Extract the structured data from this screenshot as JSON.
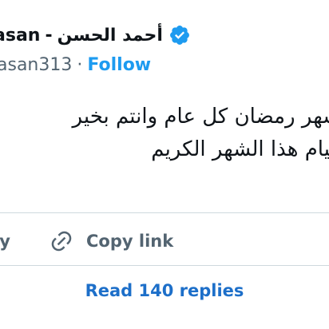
{
  "author": {
    "name_arabic": "أحمد الحسن",
    "separator": "-",
    "name_latin_fragment": "asan",
    "handle_fragment": "asan313",
    "dot": "·",
    "follow_label": "Follow",
    "verified_icon": "verified-badge-icon"
  },
  "tweet": {
    "lines": [
      "شهر رمضان كل عام وانتم بخير",
      "قيام هذا الشهر الكريم"
    ]
  },
  "actions": {
    "reply_label_fragment": "ly",
    "copy_link_label": "Copy link",
    "copy_link_icon": "link-icon"
  },
  "replies": {
    "read_label": "Read 140 replies"
  },
  "colors": {
    "accent": "#1d9bf0",
    "link": "#1d6fc9",
    "text": "#0f1419",
    "muted": "#536471",
    "divider": "#cfd9de"
  }
}
